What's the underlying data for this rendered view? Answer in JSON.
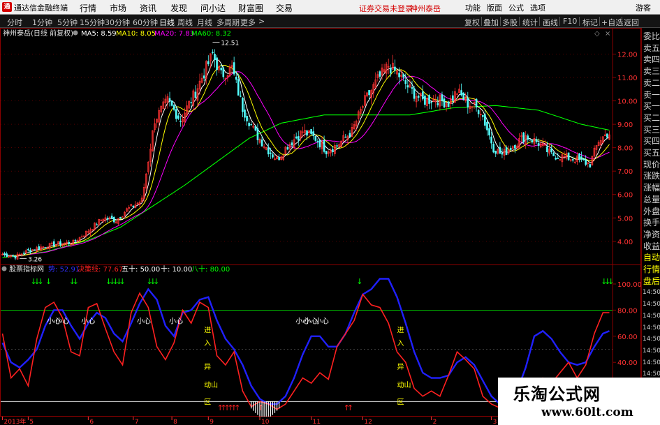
{
  "app": {
    "title": "通达信金融终端",
    "menu": [
      "行情",
      "市场",
      "资讯",
      "发现",
      "问小达",
      "财富圈",
      "交易"
    ],
    "notice": "证券交易未登录",
    "stock_tag": "神州泰岳",
    "right_menu": [
      "功能",
      "版面",
      "公式",
      "选项"
    ],
    "guest": "游客"
  },
  "periods": [
    "分时",
    "1分钟",
    "5分钟",
    "15分钟",
    "30分钟",
    "60分钟",
    "日线",
    "周线",
    "月线",
    "多周期",
    "更多"
  ],
  "active_period": "日线",
  "toolbar": [
    "复权",
    "叠加",
    "多股",
    "统计",
    "画线",
    "F10",
    "标记",
    "+自选",
    "返回"
  ],
  "sidebar": [
    "委比",
    "卖五",
    "卖四",
    "卖三",
    "卖二",
    "卖一",
    "买一",
    "买二",
    "买三",
    "买四",
    "买五",
    "现价",
    "涨跌",
    "涨幅",
    "总量",
    "外盘",
    "换手",
    "净资",
    "收益",
    "自动",
    "行情",
    "盘后",
    "14:50",
    "14:50",
    "14:50",
    "14:50",
    "14:50",
    "14:50",
    "14:50",
    "14:50",
    "14:50"
  ],
  "watermark": {
    "title": "乐淘公式网",
    "url": "www.60lt.com"
  },
  "colors": {
    "up": "#ff3232",
    "down": "#54ffff",
    "ma5": "#ffffff",
    "ma10": "#ffff00",
    "ma20": "#ff00ff",
    "ma60": "#00ff00",
    "k": "#ff2020",
    "d": "#2020ff",
    "grid_red": "#8b0000"
  },
  "chart_data": [
    {
      "type": "candlestick",
      "title": "神州泰岳(日线 前复权)",
      "legend": [
        {
          "name": "MA5",
          "value": "8.59",
          "color": "#ffffff"
        },
        {
          "name": "MA10",
          "value": "8.05",
          "color": "#ffff00"
        },
        {
          "name": "MA20",
          "value": "7.83",
          "color": "#ff00ff"
        },
        {
          "name": "MA60",
          "value": "8.32",
          "color": "#00ff00"
        }
      ],
      "ylim": [
        3.1,
        12.7
      ],
      "yticks": [
        "12.00",
        "11.00",
        "10.00",
        "9.00",
        "8.00",
        "7.00",
        "6.00",
        "5.00",
        "4.00"
      ],
      "annotations": [
        {
          "text": "12.51",
          "x": 98,
          "value": 12.51
        },
        {
          "text": "3.26",
          "x": 8,
          "value": 3.26
        }
      ],
      "anchors": [
        [
          0,
          3.45
        ],
        [
          6,
          3.35
        ],
        [
          12,
          3.6
        ],
        [
          18,
          3.75
        ],
        [
          26,
          3.9
        ],
        [
          33,
          3.95
        ],
        [
          40,
          4.45
        ],
        [
          47,
          5.0
        ],
        [
          53,
          4.9
        ],
        [
          58,
          5.35
        ],
        [
          65,
          5.75
        ],
        [
          71,
          9.2
        ],
        [
          77,
          10.0
        ],
        [
          83,
          9.2
        ],
        [
          89,
          10.2
        ],
        [
          93,
          11.0
        ],
        [
          98,
          12.0
        ],
        [
          102,
          11.1
        ],
        [
          107,
          11.4
        ],
        [
          112,
          9.7
        ],
        [
          118,
          8.6
        ],
        [
          124,
          7.9
        ],
        [
          128,
          7.5
        ],
        [
          133,
          8.1
        ],
        [
          140,
          8.7
        ],
        [
          146,
          8.4
        ],
        [
          151,
          7.9
        ],
        [
          156,
          8.1
        ],
        [
          163,
          8.7
        ],
        [
          169,
          10.0
        ],
        [
          175,
          10.9
        ],
        [
          180,
          11.5
        ],
        [
          184,
          11.2
        ],
        [
          190,
          10.5
        ],
        [
          196,
          10.0
        ],
        [
          202,
          10.1
        ],
        [
          208,
          9.9
        ],
        [
          212,
          10.4
        ],
        [
          217,
          9.9
        ],
        [
          223,
          9.6
        ],
        [
          229,
          8.0
        ],
        [
          233,
          7.7
        ],
        [
          238,
          8.1
        ],
        [
          244,
          8.5
        ],
        [
          250,
          8.2
        ],
        [
          256,
          7.7
        ],
        [
          262,
          7.6
        ],
        [
          268,
          7.5
        ],
        [
          274,
          7.3
        ],
        [
          278,
          8.3
        ],
        [
          282,
          8.6
        ]
      ],
      "ma60": [
        [
          0,
          3.3
        ],
        [
          20,
          3.55
        ],
        [
          40,
          4.05
        ],
        [
          55,
          4.6
        ],
        [
          70,
          5.5
        ],
        [
          85,
          6.4
        ],
        [
          100,
          7.4
        ],
        [
          115,
          8.4
        ],
        [
          130,
          9.05
        ],
        [
          150,
          9.4
        ],
        [
          170,
          9.4
        ],
        [
          190,
          9.4
        ],
        [
          210,
          9.7
        ],
        [
          230,
          9.8
        ],
        [
          250,
          9.6
        ],
        [
          270,
          9.0
        ],
        [
          283,
          8.75
        ]
      ]
    },
    {
      "type": "line",
      "title": "股票指标网",
      "legend": [
        {
          "name": "势",
          "value": "52.91",
          "color": "#2020ff"
        },
        {
          "name": "决策线",
          "value": "77.67",
          "color": "#ff2020"
        },
        {
          "name": "五十",
          "value": "50.00",
          "color": "#ffffff"
        },
        {
          "name": "十",
          "value": "10.00",
          "color": "#ffffff"
        },
        {
          "name": "八十",
          "value": "80.00",
          "color": "#00ff00"
        }
      ],
      "ylim": [
        0,
        108
      ],
      "yticks": [
        "100.00",
        "80.00",
        "60.00",
        "40.00"
      ],
      "k_series": [
        [
          0,
          62
        ],
        [
          4,
          28
        ],
        [
          8,
          35
        ],
        [
          12,
          22
        ],
        [
          16,
          58
        ],
        [
          20,
          82
        ],
        [
          24,
          86
        ],
        [
          28,
          74
        ],
        [
          32,
          48
        ],
        [
          36,
          45
        ],
        [
          40,
          82
        ],
        [
          44,
          85
        ],
        [
          48,
          66
        ],
        [
          52,
          48
        ],
        [
          56,
          38
        ],
        [
          60,
          78
        ],
        [
          64,
          93
        ],
        [
          68,
          82
        ],
        [
          72,
          52
        ],
        [
          76,
          42
        ],
        [
          80,
          55
        ],
        [
          84,
          80
        ],
        [
          88,
          70
        ],
        [
          92,
          86
        ],
        [
          96,
          82
        ],
        [
          100,
          45
        ],
        [
          104,
          38
        ],
        [
          108,
          48
        ],
        [
          112,
          18
        ],
        [
          116,
          6
        ],
        [
          120,
          10
        ],
        [
          124,
          8
        ],
        [
          128,
          4
        ],
        [
          132,
          8
        ],
        [
          136,
          18
        ],
        [
          140,
          28
        ],
        [
          144,
          24
        ],
        [
          148,
          32
        ],
        [
          152,
          27
        ],
        [
          156,
          52
        ],
        [
          160,
          62
        ],
        [
          164,
          72
        ],
        [
          168,
          92
        ],
        [
          172,
          84
        ],
        [
          176,
          82
        ],
        [
          180,
          70
        ],
        [
          184,
          48
        ],
        [
          188,
          40
        ],
        [
          192,
          20
        ],
        [
          196,
          14
        ],
        [
          200,
          18
        ],
        [
          204,
          14
        ],
        [
          208,
          30
        ],
        [
          212,
          48
        ],
        [
          216,
          42
        ],
        [
          220,
          35
        ],
        [
          224,
          14
        ],
        [
          228,
          8
        ],
        [
          232,
          5
        ],
        [
          236,
          4
        ],
        [
          240,
          6
        ],
        [
          244,
          7
        ],
        [
          248,
          14
        ],
        [
          252,
          28
        ],
        [
          256,
          24
        ],
        [
          260,
          32
        ],
        [
          264,
          40
        ],
        [
          268,
          28
        ],
        [
          272,
          38
        ],
        [
          276,
          62
        ],
        [
          280,
          78
        ],
        [
          283,
          78
        ]
      ],
      "d_series": [
        [
          0,
          55
        ],
        [
          4,
          40
        ],
        [
          8,
          36
        ],
        [
          12,
          42
        ],
        [
          16,
          50
        ],
        [
          20,
          68
        ],
        [
          24,
          80
        ],
        [
          28,
          80
        ],
        [
          32,
          68
        ],
        [
          36,
          58
        ],
        [
          40,
          70
        ],
        [
          44,
          78
        ],
        [
          48,
          74
        ],
        [
          52,
          62
        ],
        [
          56,
          56
        ],
        [
          60,
          70
        ],
        [
          64,
          85
        ],
        [
          68,
          96
        ],
        [
          72,
          88
        ],
        [
          76,
          68
        ],
        [
          80,
          60
        ],
        [
          84,
          78
        ],
        [
          88,
          80
        ],
        [
          92,
          88
        ],
        [
          96,
          90
        ],
        [
          100,
          72
        ],
        [
          104,
          58
        ],
        [
          108,
          50
        ],
        [
          112,
          38
        ],
        [
          116,
          22
        ],
        [
          120,
          12
        ],
        [
          124,
          8
        ],
        [
          128,
          8
        ],
        [
          132,
          14
        ],
        [
          136,
          28
        ],
        [
          140,
          46
        ],
        [
          144,
          60
        ],
        [
          148,
          60
        ],
        [
          152,
          52
        ],
        [
          156,
          52
        ],
        [
          160,
          62
        ],
        [
          164,
          78
        ],
        [
          168,
          92
        ],
        [
          172,
          96
        ],
        [
          176,
          104
        ],
        [
          180,
          104
        ],
        [
          184,
          90
        ],
        [
          188,
          70
        ],
        [
          192,
          48
        ],
        [
          196,
          32
        ],
        [
          200,
          28
        ],
        [
          204,
          28
        ],
        [
          208,
          30
        ],
        [
          212,
          40
        ],
        [
          216,
          44
        ],
        [
          220,
          38
        ],
        [
          224,
          26
        ],
        [
          228,
          14
        ],
        [
          232,
          8
        ],
        [
          236,
          6
        ],
        [
          240,
          18
        ],
        [
          244,
          36
        ],
        [
          248,
          60
        ],
        [
          252,
          64
        ],
        [
          256,
          58
        ],
        [
          260,
          48
        ],
        [
          264,
          40
        ],
        [
          268,
          38
        ],
        [
          272,
          40
        ],
        [
          276,
          52
        ],
        [
          280,
          62
        ],
        [
          283,
          64
        ]
      ],
      "down_arrows": [
        [
          14,
          3
        ],
        [
          21,
          1
        ],
        [
          32,
          2
        ],
        [
          49,
          5
        ],
        [
          68,
          3
        ],
        [
          166,
          1
        ],
        [
          280,
          3
        ]
      ],
      "up_arrows": [
        [
          101,
          6
        ],
        [
          120,
          1
        ],
        [
          160,
          2
        ]
      ],
      "labels": [
        {
          "text": "小心",
          "x": 22,
          "value": 72
        },
        {
          "text": "小心",
          "x": 26,
          "value": 72
        },
        {
          "text": "小心",
          "x": 38,
          "value": 72
        },
        {
          "text": "小心",
          "x": 64,
          "value": 72
        },
        {
          "text": "小心",
          "x": 79,
          "value": 72
        },
        {
          "text": "小心",
          "x": 138,
          "value": 72
        },
        {
          "text": "小心",
          "x": 142,
          "value": 72
        },
        {
          "text": "小心",
          "x": 147,
          "value": 72
        }
      ],
      "side_labels": [
        {
          "text": "进",
          "x": 94,
          "value": 65
        },
        {
          "text": "入",
          "x": 94,
          "value": 55
        },
        {
          "text": "异",
          "x": 94,
          "value": 37
        },
        {
          "text": "动山",
          "x": 94,
          "value": 23
        },
        {
          "text": "区",
          "x": 94,
          "value": 10
        },
        {
          "text": "进",
          "x": 184,
          "value": 65
        },
        {
          "text": "入",
          "x": 184,
          "value": 55
        },
        {
          "text": "异",
          "x": 184,
          "value": 37
        },
        {
          "text": "动山",
          "x": 184,
          "value": 23
        },
        {
          "text": "区",
          "x": 184,
          "value": 10
        }
      ]
    }
  ],
  "date_axis": [
    "2013年",
    "5",
    "6",
    "7",
    "8",
    "9",
    "10",
    "11",
    "12",
    "2",
    "3"
  ]
}
